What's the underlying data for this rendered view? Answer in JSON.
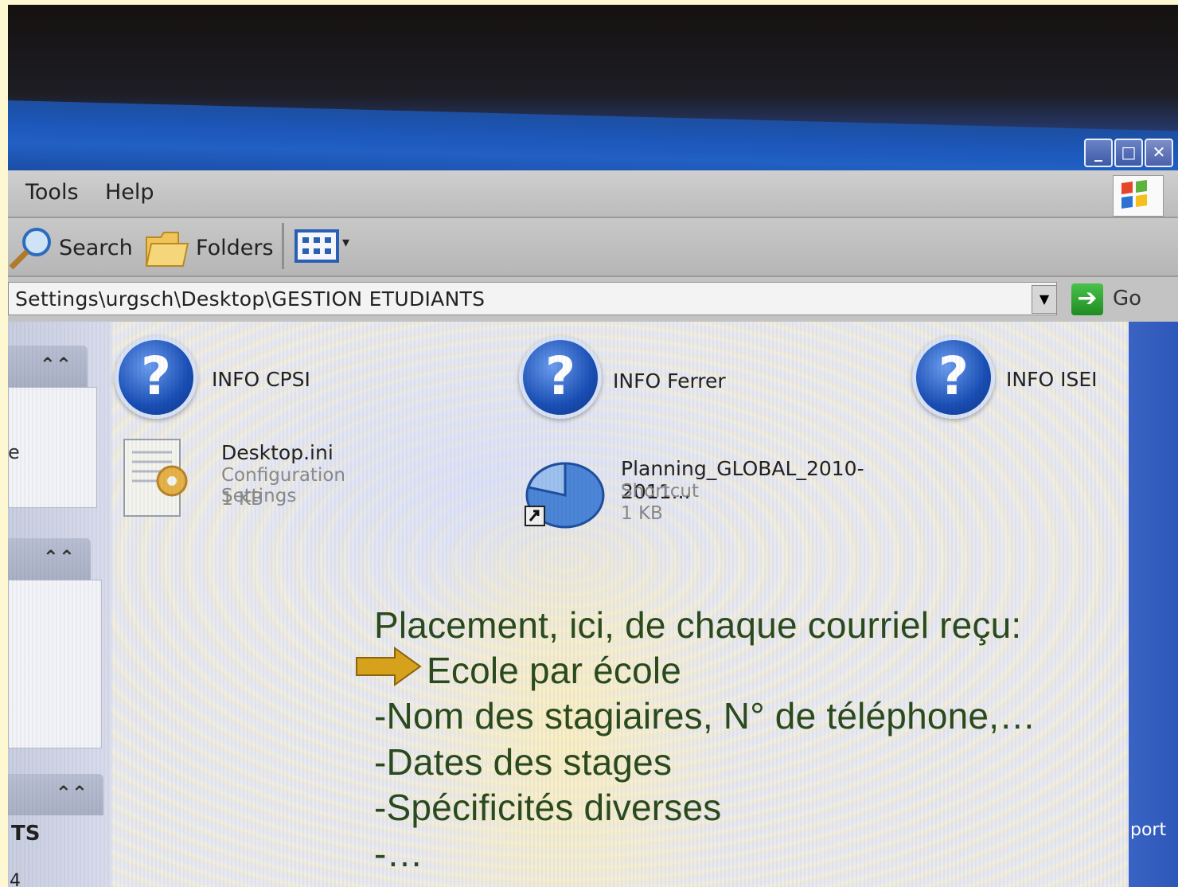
{
  "menu": {
    "items": [
      "Tools",
      "Help"
    ]
  },
  "toolbar": {
    "search_label": "Search",
    "folders_label": "Folders"
  },
  "window_buttons": {
    "minimize": "_",
    "maximize": "□",
    "close": "✕"
  },
  "address": {
    "path": "Settings\\urgsch\\Desktop\\GESTION ETUDIANTS",
    "go_label": "Go"
  },
  "taskpane": {
    "fragment_e": "e",
    "fragment_ts": "TS",
    "fragment_4": "4"
  },
  "files": [
    {
      "name": "INFO CPSI",
      "icon": "help-icon"
    },
    {
      "name": "INFO Ferrer",
      "icon": "help-icon"
    },
    {
      "name": "INFO ISEI",
      "icon": "help-icon"
    },
    {
      "name": "Desktop.ini",
      "type": "Configuration Settings",
      "size": "1 KB",
      "icon": "config-file-icon"
    },
    {
      "name": "Planning_GLOBAL_2010-2011...",
      "type": "Shortcut",
      "size": "1 KB",
      "icon": "pie-chart-shortcut-icon"
    }
  ],
  "right_edge_text": "port",
  "annotation": {
    "line1": "Placement, ici, de chaque courriel reçu:",
    "line2": "Ecole par école",
    "line3": "-Nom des stagiaires, N° de téléphone,…",
    "line4": "-Dates des stages",
    "line5": "-Spécificités diverses",
    "line6": "-…"
  },
  "colors": {
    "titlebar": "#1c56b8",
    "annotation_text": "#2a4a1e",
    "arrow_fill": "#d6a21c",
    "page_background": "#fdf7d2"
  }
}
